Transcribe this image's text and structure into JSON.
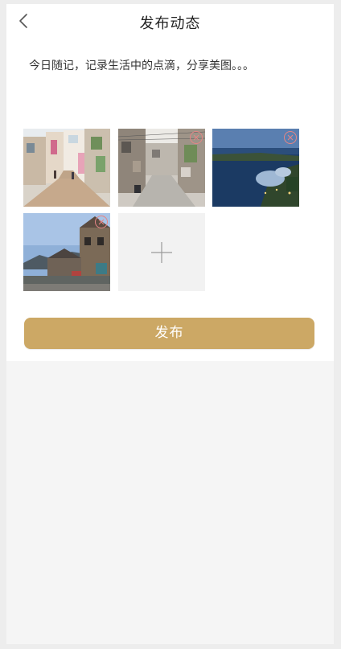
{
  "header": {
    "title": "发布动态",
    "back_icon": "chevron-left-icon"
  },
  "post": {
    "text": "今日随记，记录生活中的点滴，分享美图。。。"
  },
  "photos": [
    {
      "name": "street-alley-shops",
      "removable": false
    },
    {
      "name": "narrow-lane-houses",
      "removable": true
    },
    {
      "name": "bay-night-dome",
      "removable": true
    },
    {
      "name": "stone-village-houses",
      "removable": true
    }
  ],
  "add_tile": {
    "icon": "plus-icon"
  },
  "publish_button": {
    "label": "发布"
  },
  "colors": {
    "accent": "#cca865",
    "delete_icon": "#e58585",
    "background": "#f5f5f5"
  }
}
